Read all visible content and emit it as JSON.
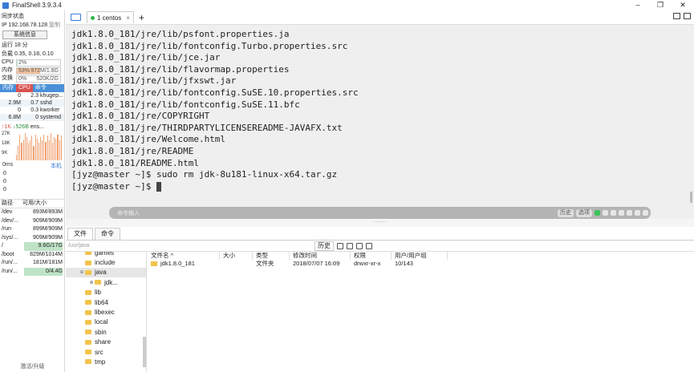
{
  "window": {
    "title": "FinalShell 3.9.3.4"
  },
  "sidebar": {
    "sync_status": "同步状态",
    "ip_label": "IP 192.168.78.128",
    "copy_label": "复制",
    "sysinfo_button": "系统信息",
    "uptime": "运行 18 分",
    "load": "负载 0.35, 0.18, 0.10",
    "cpu": {
      "label": "CPU",
      "value": "2%",
      "percent": 2
    },
    "mem": {
      "label": "内存",
      "percent_text": "53%",
      "value": "972M/1.8G",
      "percent": 53
    },
    "swap": {
      "label": "交换",
      "percent_text": "0%",
      "value": "520K/2G",
      "percent": 0
    },
    "proc_tabs": [
      "内存",
      "CPU",
      "命令"
    ],
    "processes": [
      {
        "mem": "0",
        "cpu": "2.3",
        "cmd": "khugep..."
      },
      {
        "mem": "2.9M",
        "cpu": "0.7",
        "cmd": "sshd"
      },
      {
        "mem": "0",
        "cpu": "0.3",
        "cmd": "kworker"
      },
      {
        "mem": "6.8M",
        "cpu": "0",
        "cmd": "systemd"
      }
    ],
    "net": {
      "up": "↑1K",
      "down": "↓526B",
      "iface": "ens...",
      "y_labels": [
        "27K",
        "18K",
        "9K"
      ],
      "bars": [
        0.2,
        0.5,
        0.9,
        0.6,
        0.7,
        0.95,
        0.8,
        0.6,
        0.7,
        0.85,
        0.5,
        0.9,
        0.75,
        0.6,
        0.8,
        0.7,
        0.9,
        0.65,
        0.85,
        0.7,
        0.95,
        0.6,
        0.8,
        0.75,
        0.9,
        0.7,
        0.85
      ]
    },
    "latency": {
      "unit": "0ms",
      "host": "本机",
      "values": [
        "0",
        "0",
        "0"
      ]
    },
    "disk_headers": [
      "路径",
      "可用/大小"
    ],
    "disks": [
      {
        "path": "/dev",
        "size": "893M/893M",
        "highlight": false
      },
      {
        "path": "/dev/...",
        "size": "909M/909M",
        "highlight": false
      },
      {
        "path": "/run",
        "size": "899M/909M",
        "highlight": false
      },
      {
        "path": "/sys/...",
        "size": "909M/909M",
        "highlight": false
      },
      {
        "path": "/",
        "size": "9.6G/17G",
        "highlight": true
      },
      {
        "path": "/boot",
        "size": "829M/1014M",
        "highlight": false
      },
      {
        "path": "/run/...",
        "size": "181M/181M",
        "highlight": false
      },
      {
        "path": "/run/...",
        "size": "0/4.4G",
        "highlight": true
      }
    ],
    "footer": "激活/升级"
  },
  "tabs": [
    {
      "label": "1 centos",
      "close": "×"
    }
  ],
  "add_tab": "+",
  "terminal": {
    "lines": [
      "jdk1.8.0_181/jre/lib/psfont.properties.ja",
      "jdk1.8.0_181/jre/lib/fontconfig.Turbo.properties.src",
      "jdk1.8.0_181/jre/lib/jce.jar",
      "jdk1.8.0_181/jre/lib/flavormap.properties",
      "jdk1.8.0_181/jre/lib/jfxswt.jar",
      "jdk1.8.0_181/jre/lib/fontconfig.SuSE.10.properties.src",
      "jdk1.8.0_181/jre/lib/fontconfig.SuSE.11.bfc",
      "jdk1.8.0_181/jre/COPYRIGHT",
      "jdk1.8.0_181/jre/THIRDPARTYLICENSEREADME-JAVAFX.txt",
      "jdk1.8.0_181/jre/Welcome.html",
      "jdk1.8.0_181/jre/README",
      "jdk1.8.0_181/README.html",
      "[jyz@master ~]$ sudo rm jdk-8u181-linux-x64.tar.gz"
    ],
    "prompt": "[jyz@master ~]$ "
  },
  "command_bar": {
    "placeholder": "命令输入",
    "history": "历史",
    "options": "选项"
  },
  "bottom_tabs": [
    "文件",
    "命令"
  ],
  "file_panel": {
    "path": "/usr/java",
    "history_button": "历史",
    "tree": [
      {
        "label": "games",
        "indent": 1,
        "toggle": "",
        "selected": false
      },
      {
        "label": "include",
        "indent": 1,
        "toggle": "",
        "selected": false
      },
      {
        "label": "java",
        "indent": 1,
        "toggle": "⊖",
        "selected": true
      },
      {
        "label": "jdk...",
        "indent": 2,
        "toggle": "⊕",
        "selected": false
      },
      {
        "label": "lib",
        "indent": 1,
        "toggle": "",
        "selected": false
      },
      {
        "label": "lib64",
        "indent": 1,
        "toggle": "",
        "selected": false
      },
      {
        "label": "libexec",
        "indent": 1,
        "toggle": "",
        "selected": false
      },
      {
        "label": "local",
        "indent": 1,
        "toggle": "",
        "selected": false
      },
      {
        "label": "sbin",
        "indent": 1,
        "toggle": "",
        "selected": false
      },
      {
        "label": "share",
        "indent": 1,
        "toggle": "",
        "selected": false
      },
      {
        "label": "src",
        "indent": 1,
        "toggle": "",
        "selected": false
      },
      {
        "label": "tmp",
        "indent": 1,
        "toggle": "",
        "selected": false
      }
    ],
    "columns": [
      "文件名 ^",
      "大小",
      "类型",
      "修改时间",
      "权限",
      "用户/用户组"
    ],
    "files": [
      {
        "name": "jdk1.8.0_181",
        "size": "",
        "type": "文件夹",
        "modified": "2018/07/07 16:09",
        "perm": "drwxr-xr-x",
        "owner": "10/143"
      }
    ]
  }
}
